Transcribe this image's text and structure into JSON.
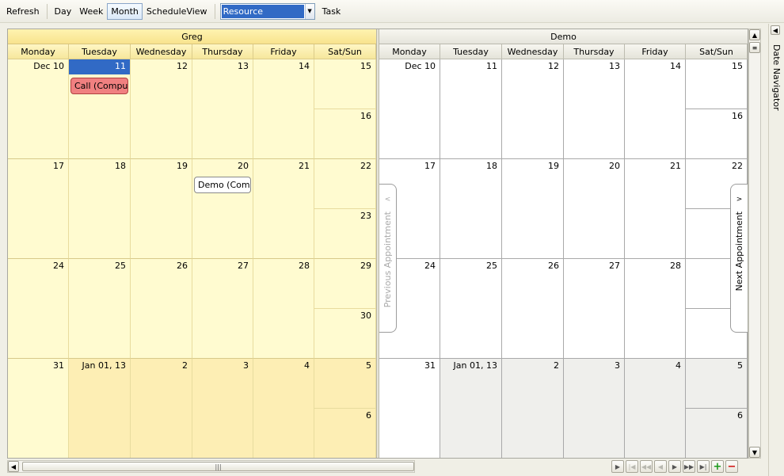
{
  "toolbar": {
    "refresh": "Refresh",
    "day": "Day",
    "week": "Week",
    "month": "Month",
    "schedule_view": "ScheduleView",
    "group_by": "Resource",
    "task": "Task"
  },
  "day_names": [
    "Monday",
    "Tuesday",
    "Wednesday",
    "Thursday",
    "Friday",
    "Sat/Sun"
  ],
  "resources": [
    {
      "name": "Greg",
      "weeks": [
        {
          "days": [
            "Dec 10",
            "11",
            "12",
            "13",
            "14",
            "15"
          ],
          "sun": "16"
        },
        {
          "days": [
            "17",
            "18",
            "19",
            "20",
            "21",
            "22"
          ],
          "sun": "23"
        },
        {
          "days": [
            "24",
            "25",
            "26",
            "27",
            "28",
            "29"
          ],
          "sun": "30"
        },
        {
          "days": [
            "31",
            "Jan 01, 13",
            "2",
            "3",
            "4",
            "5"
          ],
          "sun": "6"
        }
      ],
      "appointments": [
        {
          "label": "Call (Compum",
          "week": 0,
          "day": 1
        },
        {
          "label": "Demo (Compu",
          "week": 1,
          "day": 3
        }
      ]
    },
    {
      "name": "Demo",
      "weeks": [
        {
          "days": [
            "Dec 10",
            "11",
            "12",
            "13",
            "14",
            "15"
          ],
          "sun": "16"
        },
        {
          "days": [
            "17",
            "18",
            "19",
            "20",
            "21",
            "22"
          ],
          "sun": ""
        },
        {
          "days": [
            "24",
            "25",
            "26",
            "27",
            "28",
            ""
          ],
          "sun": ""
        },
        {
          "days": [
            "31",
            "Jan 01, 13",
            "2",
            "3",
            "4",
            "5"
          ],
          "sun": "6"
        }
      ],
      "appointments": []
    }
  ],
  "nav": {
    "previous": "Previous Appointment",
    "next": "Next Appointment"
  },
  "side_panel": "Date Navigator"
}
